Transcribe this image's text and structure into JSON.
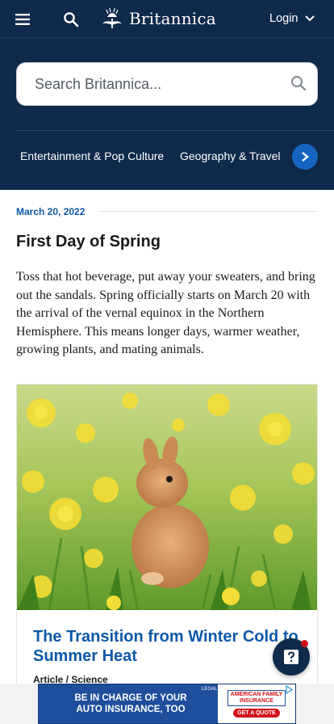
{
  "header": {
    "brand": "Britannica",
    "login_label": "Login"
  },
  "search": {
    "placeholder": "Search Britannica..."
  },
  "categories": [
    {
      "label": "Entertainment & Pop Culture"
    },
    {
      "label": "Geography & Travel"
    }
  ],
  "article": {
    "date": "March 20, 2022",
    "title": "First Day of Spring",
    "body": "Toss that hot beverage, put away your sweaters, and bring out the sandals. Spring officially starts on March 20 with the arrival of the vernal equinox in the Northern Hemisphere. This means longer days, warmer weather, growing plants, and mating animals."
  },
  "card": {
    "title": "The Transition from Winter Cold to Summer Heat",
    "meta": "Article / Science"
  },
  "ad": {
    "headline_line1": "BE IN CHARGE OF YOUR",
    "headline_line2": "AUTO INSURANCE, TOO",
    "brand_line1": "AMERICAN FAMILY",
    "brand_line2": "INSURANCE",
    "cta": "GET A QUOTE",
    "legal": "LEGAL"
  },
  "colors": {
    "header_bg": "#0f2a4a",
    "accent_blue": "#0d58a8",
    "button_blue": "#1565c0",
    "notification_red": "#d0121b"
  },
  "icons": {
    "menu": "menu-icon",
    "search": "search-icon",
    "logo": "thistle-logo-icon",
    "login_chevron": "chevron-down-icon",
    "category_next": "chevron-right-icon",
    "help": "help-question-icon",
    "ad_choices": "ad-choices-icon"
  }
}
